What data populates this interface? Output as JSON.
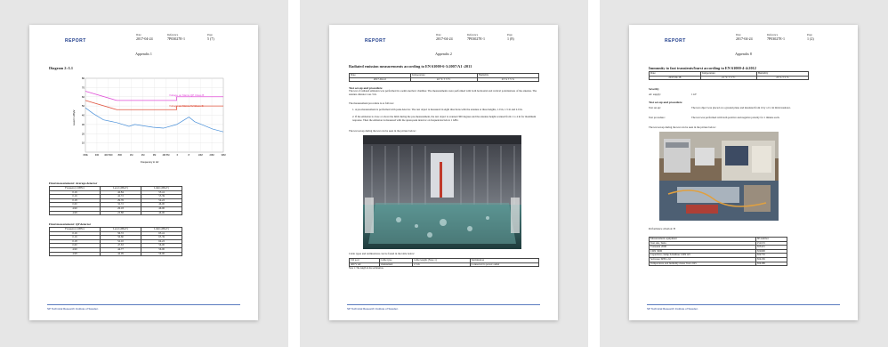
{
  "common": {
    "logo": "REPORT",
    "date_label": "Date",
    "reference_label": "Reference",
    "page_label": "Page",
    "date": "2017-04-24",
    "reference": "7P03027E-1",
    "footer": "SP Technical Research Institute of Sweden"
  },
  "page1": {
    "page_no": "5 (7)",
    "appendix": "Appendix 1",
    "diagram_title": "Diagram 2: L1",
    "chart_legend": [
      "Voltage on Mains QP Class B",
      "Voltage on Mains AV Class B"
    ],
    "xticks": [
      "150k",
      "300",
      "400 500",
      "800",
      "1M",
      "2M",
      "3M",
      "4M 5M",
      "6",
      "8",
      "10M",
      "20M",
      "30M"
    ],
    "xlabel": "Frequency in Hz",
    "ylabel": "Level in dBµV",
    "yticks": [
      "80",
      "70",
      "60",
      "50",
      "40",
      "30",
      "20",
      "10"
    ],
    "avg_title": "Final measurement: Average detector",
    "avg_headers": [
      "Frequency (MHz)",
      "Level (dBµV)",
      "Limit (dBµV)"
    ],
    "avg_rows": [
      [
        "0.16",
        "42.84",
        "55.41"
      ],
      [
        "0.16",
        "42.72",
        "55.39"
      ],
      [
        "0.18",
        "29.76",
        "54.22"
      ],
      [
        "0.60",
        "32.72",
        "46.00"
      ],
      [
        "4.90",
        "26.18",
        "46.00"
      ],
      [
        "4.98",
        "23.88",
        "46.00"
      ]
    ],
    "qp_title": "Final measurement: QP detector",
    "qp_headers": [
      "Frequency (MHz)",
      "Level (dBµV)",
      "Limit (dBµV)"
    ],
    "qp_rows": [
      [
        "0.16",
        "56.72",
        "65.41"
      ],
      [
        "0.16",
        "56.60",
        "65.39"
      ],
      [
        "0.18",
        "52.10",
        "64.22"
      ],
      [
        "0.60",
        "47.63",
        "56.00"
      ],
      [
        "4.90",
        "44.77",
        "56.00"
      ],
      [
        "4.98",
        "44.09",
        "56.00"
      ]
    ]
  },
  "page2": {
    "page_no": "1 (8)",
    "appendix": "Appendix 2",
    "title": "Radiated emission measurements according to EN 61000-6-3:2007/A1 :2011",
    "cond_headers": [
      "Date",
      "Temperature",
      "Humidity"
    ],
    "cond_values": [
      "2017-04-12",
      "22 °C ± 3 °C",
      "23 % ± 5 %"
    ],
    "setup_title": "Test set-up and procedure",
    "setup_text": "The test of radiated emission was performed in a semi anechoic chamber. The measurements were performed with both horizontal and vertical polarizations of the antenna. The antenna distance was 3 m.",
    "procedure_intro": "The measurement procedure is as follows:",
    "steps": [
      "1. A pre-measurement is performed with peak detector. The test object is measured in eight directions with the antenna at three heights, 1.0 m, 1.5 m and 2.0 m.",
      "2. If the emission is close or above the limit during the pre-measurement, the test object is scanned 360 degrees and the antenna height scanned from 1 to 4 m for maximum response. Then the emission is measured with the quasi-peak detector on frequencies below 1 GHz."
    ],
    "photo_caption": "The test set-up during the test can be seen in the picture below:",
    "cables_intro": "Cable types and terminations can be found in the table below:",
    "cable_headers": [
      "I/O port",
      "Cable type",
      "Cable length (Note 1)",
      "Termination"
    ],
    "cable_row": [
      "400 V AC",
      "Unshielded",
      "1.5 m",
      "Connected to power outlet"
    ],
    "note": "Note 1: The length in the termination."
  },
  "page3": {
    "page_no": "1 (2)",
    "appendix": "Appendix 8",
    "title": "Immunity to fast transients/burst according to EN 61000-4-4:2012",
    "cond_headers": [
      "Date",
      "Temperature",
      "Humidity"
    ],
    "cond_values": [
      "2017-04-18",
      "21 °C ± 3 °C",
      "23 % ± 5 %"
    ],
    "severity_title": "Severity",
    "severity_label": "AC supply:",
    "severity_value": "1 kV",
    "setup_title": "Test set-up and procedure",
    "setup_label": "Test set-up:",
    "setup_text": "The test object was placed on a ground plane and insulated from it by a 0.1 m thick insulator.",
    "proc_label": "Test procedure:",
    "proc_text": "The test was performed with both positive and negative polarity for 1 minute each.",
    "photo_caption": "The test set-up during the test can be seen in the picture below:",
    "criterion": "Performance criterion: B",
    "equip_headers": [
      "Measurement equipment",
      "SP number"
    ],
    "equip_rows": [
      [
        "Test site, Tesla",
        "151153"
      ],
      [
        "Transient 2000",
        "503415"
      ],
      [
        "CDN 3000",
        "502668"
      ],
      [
        "Capacitive clamp Schaffner CDN125",
        "502770"
      ],
      [
        "Software SPEL 2.0",
        "504136"
      ],
      [
        "Temperature and humidity meter Testo 625",
        "504188"
      ]
    ]
  },
  "chart_data": {
    "type": "line",
    "title": "Diagram 2: L1",
    "xlabel": "Frequency in Hz",
    "ylabel": "Level in dBµV",
    "xscale": "log",
    "xlim": [
      150000,
      30000000
    ],
    "ylim": [
      0,
      80
    ],
    "series": [
      {
        "name": "Voltage on Mains QP Class B",
        "x": [
          0.15,
          0.5,
          0.5,
          5,
          5,
          30
        ],
        "y": [
          66,
          56,
          56,
          56,
          60,
          60
        ]
      },
      {
        "name": "Voltage on Mains AV Class B",
        "x": [
          0.15,
          0.5,
          0.5,
          5,
          5,
          30
        ],
        "y": [
          56,
          46,
          46,
          46,
          50,
          50
        ]
      },
      {
        "name": "Measurement",
        "x": [
          0.15,
          0.2,
          0.3,
          0.5,
          0.8,
          1,
          2,
          3,
          5,
          8,
          10,
          20,
          30
        ],
        "y": [
          48,
          42,
          35,
          32,
          28,
          30,
          27,
          26,
          30,
          38,
          33,
          25,
          22
        ]
      }
    ],
    "colors": {
      "qp_limit": "#e04fd8",
      "av_limit": "#e0543f",
      "trace": "#4a90d9",
      "markers": "#2a8a2a"
    }
  }
}
